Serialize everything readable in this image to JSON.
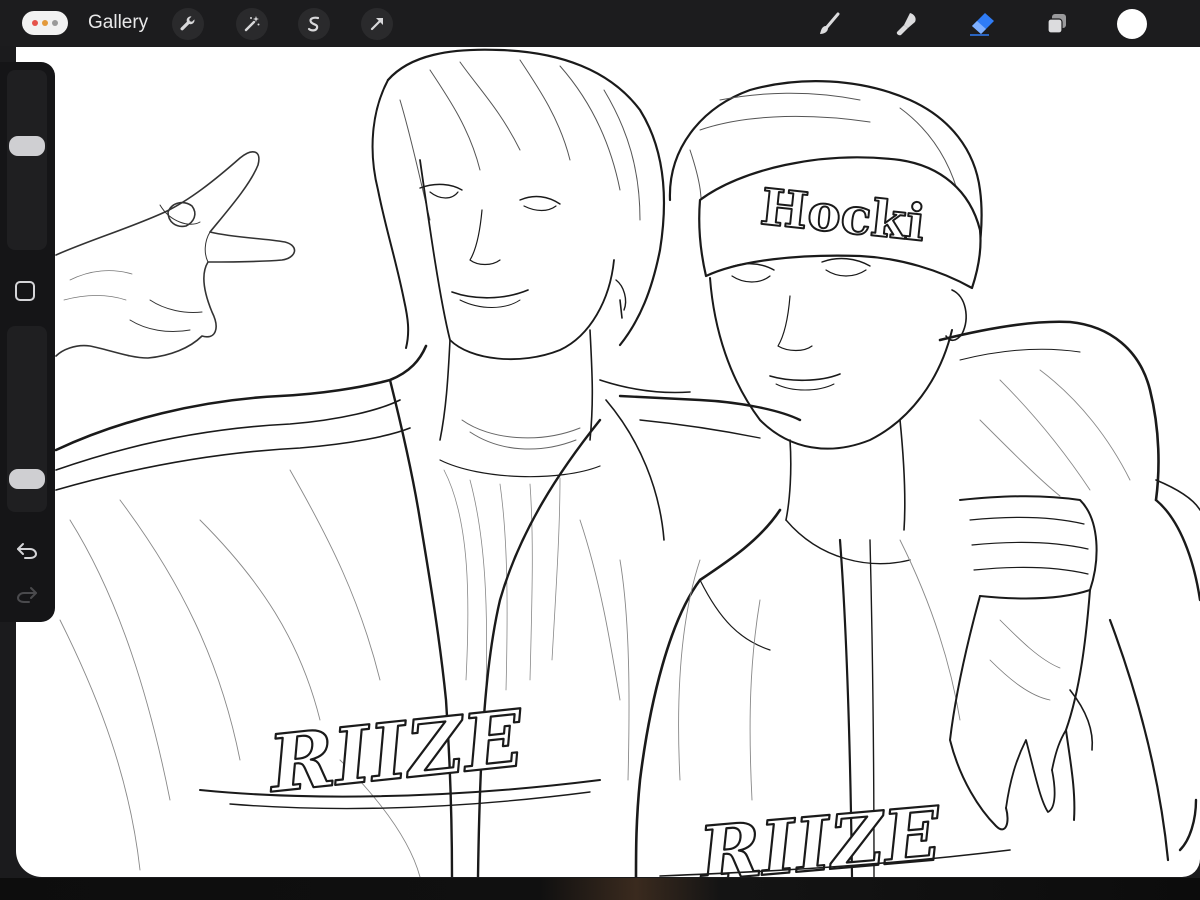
{
  "toolbar": {
    "actions_icon": "ellipsis-icon",
    "gallery_label": "Gallery",
    "left_tools": [
      "wrench-icon",
      "magic-wand-icon",
      "selection-s-icon",
      "transform-arrow-icon"
    ],
    "right_tools": [
      "brush-icon",
      "smudge-icon",
      "eraser-icon",
      "layers-icon",
      "color-circle-icon"
    ],
    "active_tool": "eraser-icon",
    "colors": {
      "dot_red": "#e5534b",
      "dot_orange": "#e39a3b",
      "dot_gray": "#9a9a9a",
      "accent": "#2f7cf6",
      "current_color": "#ffffff"
    }
  },
  "sidebar": {
    "brush_size_level": 0.59,
    "opacity_level": 0.13,
    "modifier_icon": "square-modifier-icon",
    "undo_icon": "undo-arrow-icon",
    "redo_icon": "redo-arrow-icon",
    "redo_enabled": false
  },
  "canvas": {
    "headband_text": "Hocki",
    "jacket_text_left": "RIIZE",
    "jacket_text_right": "RIIZE"
  }
}
